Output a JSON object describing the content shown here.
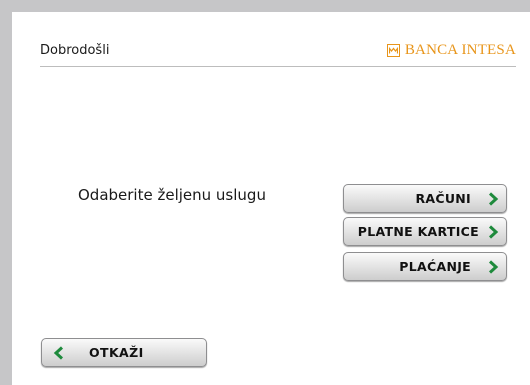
{
  "header": {
    "welcome": "Dobrodošli",
    "logo_text": "BANCA INTESA"
  },
  "main": {
    "prompt": "Odaberite željenu uslugu",
    "menu": [
      {
        "label": "RAČUNI"
      },
      {
        "label": "PLATNE KARTICE"
      },
      {
        "label": "PLAĆANJE"
      }
    ],
    "cancel_label": "OTKAŽI"
  },
  "colors": {
    "brand": "#e8951a",
    "chevron": "#1e8a3c",
    "frame": "#c6c6c8"
  },
  "icons": {
    "logo": "bank-logo-icon",
    "forward": "chevron-right-icon",
    "back": "chevron-left-icon"
  }
}
